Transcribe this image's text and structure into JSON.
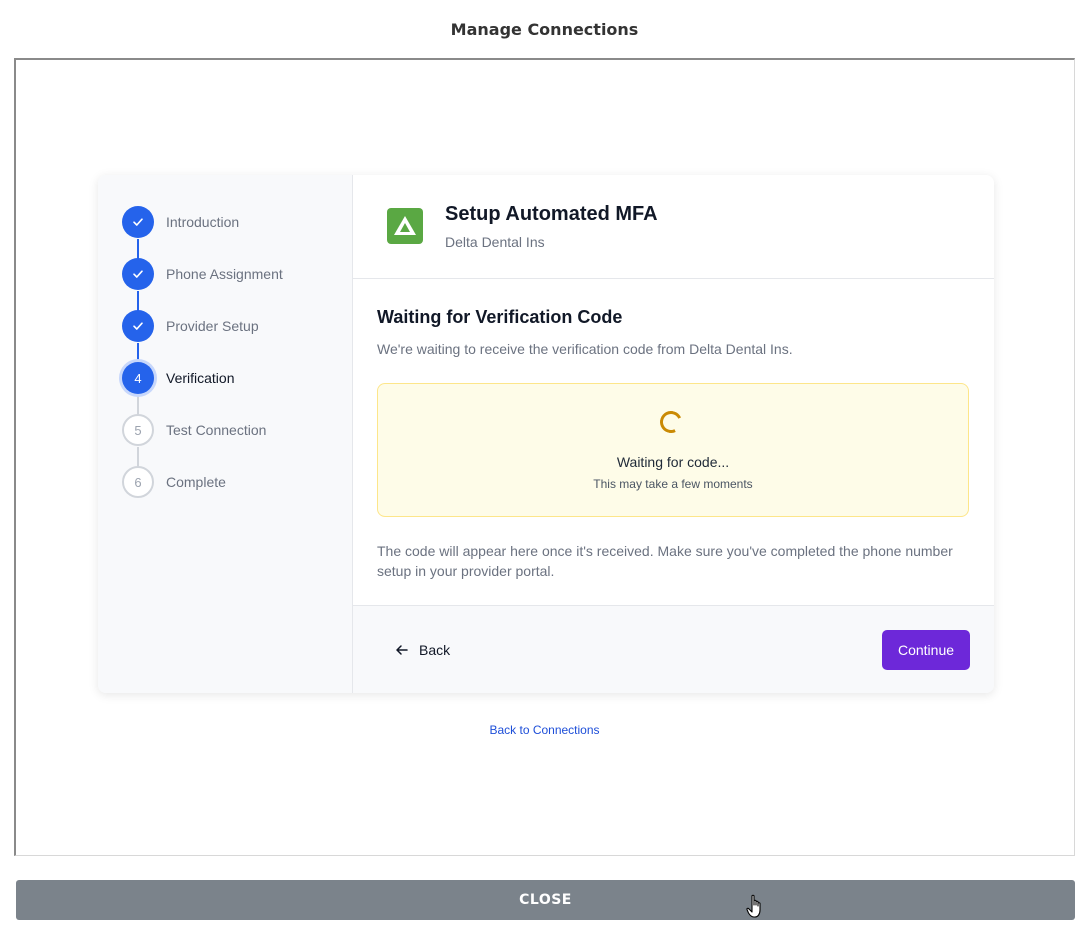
{
  "modal": {
    "title": "Manage Connections",
    "close_label": "CLOSE"
  },
  "steps": [
    {
      "label": "Introduction",
      "number": "",
      "state": "done"
    },
    {
      "label": "Phone Assignment",
      "number": "",
      "state": "done"
    },
    {
      "label": "Provider Setup",
      "number": "",
      "state": "done"
    },
    {
      "label": "Verification",
      "number": "4",
      "state": "current"
    },
    {
      "label": "Test Connection",
      "number": "5",
      "state": "pending"
    },
    {
      "label": "Complete",
      "number": "6",
      "state": "pending"
    }
  ],
  "header": {
    "title": "Setup Automated MFA",
    "subtitle": "Delta Dental Ins",
    "logo_icon": "delta-logo-icon"
  },
  "content": {
    "title": "Waiting for Verification Code",
    "description": "We're waiting to receive the verification code from Delta Dental Ins.",
    "wait_title": "Waiting for code...",
    "wait_subtitle": "This may take a few moments",
    "note": "The code will appear here once it's received. Make sure you've completed the phone number setup in your provider portal."
  },
  "footer": {
    "back_label": "Back",
    "continue_label": "Continue"
  },
  "links": {
    "back_to_connections": "Back to Connections"
  },
  "colors": {
    "primary": "#2563eb",
    "accent": "#6d28d9",
    "waiting_bg": "#fefce8",
    "close_bar": "#7b838b"
  }
}
